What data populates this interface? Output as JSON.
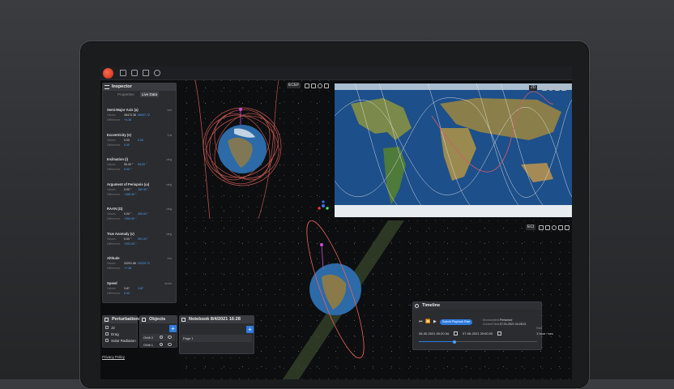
{
  "inspector": {
    "title": "Inspector",
    "tabs": [
      "Properties",
      "Live Data"
    ],
    "properties": [
      {
        "label": "Semi-Major Axis (a)",
        "unit": "km",
        "values_label": "Values",
        "values": "38470.38",
        "values2": "38907.72",
        "diff_label": "Difference",
        "diff": "+4.36"
      },
      {
        "label": "Eccentricity (e)",
        "unit": "1/a",
        "values_label": "Values",
        "values": "0.00",
        "values2": "0.00",
        "diff_label": "Difference",
        "diff": "0.00"
      },
      {
        "label": "Inclination (i)",
        "unit": "deg",
        "values_label": "Values",
        "values": "55.00 °",
        "values2": "55.00 °",
        "diff_label": "Difference",
        "diff": "0.00 °"
      },
      {
        "label": "Argument of Periapsis (ω)",
        "unit": "deg",
        "values_label": "Values",
        "values": "0.00 °",
        "values2": "180.30 °",
        "diff_label": "Difference",
        "diff": "+180.30 °"
      },
      {
        "label": "RAAN (Ω)",
        "unit": "deg",
        "values_label": "Values",
        "values": "0.00 °",
        "values2": "300.00 °",
        "diff_label": "Difference",
        "diff": "+300.00 °"
      },
      {
        "label": "True Anomaly (ν)",
        "unit": "deg",
        "values_label": "Values",
        "values": "0.00 °",
        "values2": "291.20 °",
        "diff_label": "Difference",
        "diff": "+291.20 °"
      },
      {
        "label": "Altitude",
        "unit": "km",
        "values_label": "Values",
        "values": "20201.86",
        "values2": "20229.72",
        "diff_label": "Difference",
        "diff": "+7.36"
      },
      {
        "label": "Speed",
        "unit": "km/s",
        "values_label": "Values",
        "values": "3.87",
        "values2": "3.87",
        "diff_label": "Difference",
        "diff": "0.00"
      }
    ]
  },
  "views": {
    "view1_frame": "ECEF",
    "map_mode": "2D",
    "view3_frame": "ECI"
  },
  "perturbations": {
    "title": "Perturbations",
    "items": [
      "J2",
      "Drag",
      "Solar Radiation"
    ]
  },
  "objects": {
    "title": "Objects",
    "items": [
      "Orbit 2",
      "Orbit 1"
    ]
  },
  "notebook": {
    "title": "Notebook 8/4/2021 16:28",
    "page": "Page 1"
  },
  "timeline": {
    "title": "Timeline",
    "submit": "Submit Playback Rate",
    "env_label": "Environment:",
    "env_value": "Perturbed",
    "current_label": "Current Time:",
    "current_value": "07-01-2021 04:28:21",
    "start": "06-30-2021 00:20:34",
    "end": "07-06-2021 20:00:00",
    "rate_label": "Rate",
    "rate": "1 hour / sec",
    "progress": 0.3
  },
  "footer": {
    "privacy": "Privacy Policy"
  },
  "colors": {
    "accent": "#2d7be0",
    "orbit": "#e8645a",
    "magenta": "#d04bd8",
    "ground_track": "#e8e8e8"
  }
}
